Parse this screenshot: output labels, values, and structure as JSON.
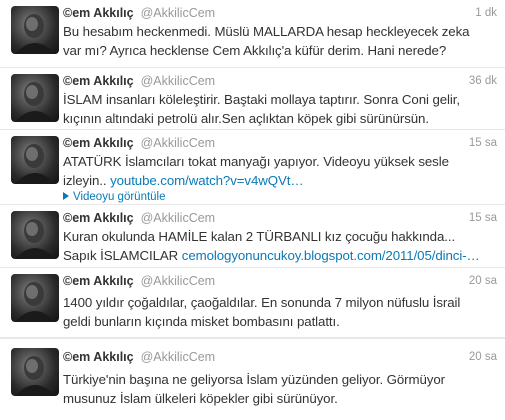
{
  "tweets": [
    {
      "name": "©em Akkılıç",
      "handle": "@AkkilicCem",
      "time": "1 dk",
      "line1": "Bu hesabım heckenmedi. Müslü MALLARDA hesap heckleyecek zeka",
      "line2": "var mı? Ayrıca hecklense Cem Akkılıç'a küfür derim. Hani nerede?"
    },
    {
      "name": "©em Akkılıç",
      "handle": "@AkkilicCem",
      "time": "36 dk",
      "line1": "İSLAM insanları köleleştirir. Baştaki mollaya taptırır. Sonra Coni gelir,",
      "line2": "kıçının altındaki petrolü alır.Sen açlıktan köpek gibi sürünürsün."
    },
    {
      "name": "©em Akkılıç",
      "handle": "@AkkilicCem",
      "time": "15 sa",
      "line1": "ATATÜRK İslamcıları tokat manyağı yapıyor. Videoyu yüksek sesle",
      "line2_text": "izleyin..",
      "line2_link": "youtube.com/watch?v=v4wQVt…",
      "media_label": "Videoyu görüntüle"
    },
    {
      "name": "©em Akkılıç",
      "handle": "@AkkilicCem",
      "time": "15 sa",
      "line1": "Kuran okulunda HAMİLE kalan 2 TÜRBANLI kız çocuğu hakkında...",
      "line2_text": "Sapık İSLAMCILAR",
      "line2_link": "cemologyonuncukoy.blogspot.com/2011/05/dinci-…"
    },
    {
      "name": "©em Akkılıç",
      "handle": "@AkkilicCem",
      "time": "20 sa",
      "line1": "1400 yıldır çoğaldılar, çaoğaldılar. En sonunda 7 milyon nüfuslu İsrail",
      "line2": "geldi bunların kıçında misket bombasını patlattı."
    },
    {
      "name": "©em Akkılıç",
      "handle": "@AkkilicCem",
      "time": "20 sa",
      "line1": "Türkiye'nin başına ne geliyorsa İslam yüzünden geliyor. Görmüyor",
      "line2": "musunuz İslam ülkeleri köpekler gibi sürünüyor."
    }
  ]
}
